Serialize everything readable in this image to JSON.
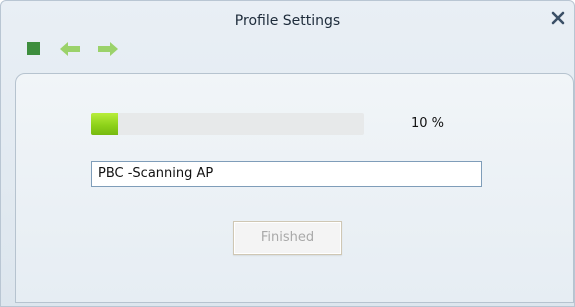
{
  "window": {
    "title": "Profile Settings",
    "close_icon": "close-icon"
  },
  "toolbar": {
    "buttons": [
      {
        "icon": "stop-icon",
        "color": "#3e8e3e"
      },
      {
        "icon": "back-arrow-icon",
        "color": "#9bd26a"
      },
      {
        "icon": "forward-arrow-icon",
        "color": "#9bd26a"
      }
    ]
  },
  "progress": {
    "value": 0.1,
    "percent_text": "10 %",
    "fill_color": "#8ed21a"
  },
  "status": {
    "value": "PBC -Scanning AP"
  },
  "actions": {
    "finished_label": "Finished",
    "finished_enabled": false
  }
}
